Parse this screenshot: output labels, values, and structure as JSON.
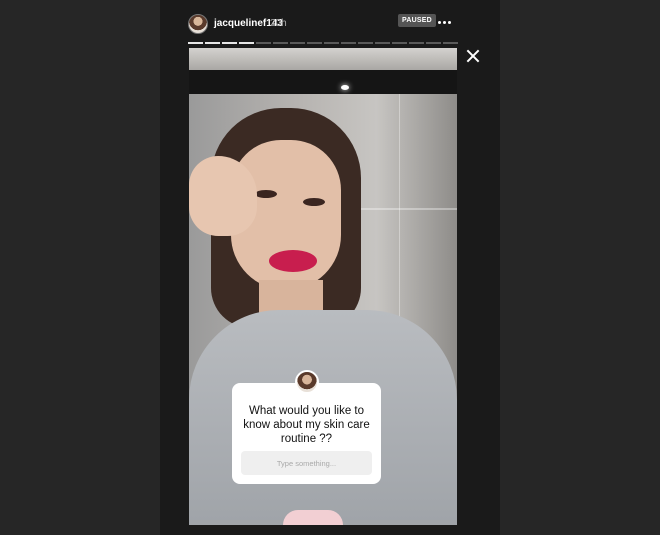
{
  "header": {
    "username": "jacquelinef143",
    "time": "20h",
    "status_badge": "PAUSED",
    "more_icon": "more-horizontal-icon",
    "close_icon": "close-icon"
  },
  "progress": {
    "total_segments": 16,
    "completed_segments": 4
  },
  "question_sticker": {
    "prompt": "What would you like to know about my skin care routine ??",
    "input_placeholder": "Type something..."
  },
  "colors": {
    "background": "#262626",
    "card": "#ffffff",
    "lips": "#c81e4e"
  }
}
